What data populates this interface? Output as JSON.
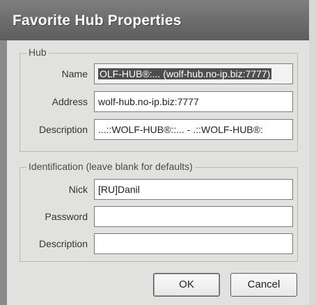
{
  "window": {
    "title": "Favorite Hub Properties"
  },
  "hub_group": {
    "legend": "Hub",
    "name_label": "Name",
    "name_value": "OLF-HUB®:... (wolf-hub.no-ip.biz:7777)",
    "address_label": "Address",
    "address_value": "wolf-hub.no-ip.biz:7777",
    "description_label": "Description",
    "description_value": "...::WOLF-HUB®::...    -  .::WOLF-HUB®:"
  },
  "identification_group": {
    "legend": "Identification (leave blank for defaults)",
    "nick_label": "Nick",
    "nick_value": "[RU]Danil",
    "password_label": "Password",
    "password_value": "",
    "description_label": "Description",
    "description_value": ""
  },
  "buttons": {
    "ok_label": "OK",
    "cancel_label": "Cancel"
  }
}
